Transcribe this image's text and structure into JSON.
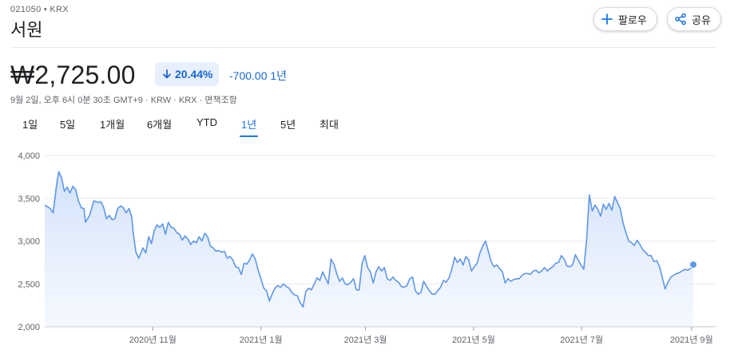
{
  "stock": {
    "ticker_line": "021050 • KRX",
    "name": "서원",
    "price": "₩2,725.00",
    "change_percent": "20.44%",
    "change_value": "-700.00 1년",
    "meta": "9월 2일, 오후 6시 0분 30초 GMT+9 · KRW · KRX · 면책조항"
  },
  "actions": {
    "follow_label": "팔로우",
    "share_label": "공유"
  },
  "tabs": [
    {
      "label": "1일"
    },
    {
      "label": "5일"
    },
    {
      "label": "1개월"
    },
    {
      "label": "6개월"
    },
    {
      "label": "YTD"
    },
    {
      "label": "1년"
    },
    {
      "label": "5년"
    },
    {
      "label": "최대"
    }
  ],
  "active_tab": "1년",
  "colors": {
    "line": "#5e97e8",
    "fill": "#dbe7fb",
    "accent": "#1a73e8",
    "change": "#1967d2"
  },
  "chart_data": {
    "type": "area",
    "ylim": [
      2000,
      4000
    ],
    "y_ticks": [
      4000,
      3500,
      3000,
      2500,
      2000
    ],
    "y_tick_labels": [
      "4,000",
      "3,500",
      "3,000",
      "2,500",
      "2,000"
    ],
    "x_ticks": [
      {
        "label": "2020년 11월",
        "day": 61
      },
      {
        "label": "2021년 1월",
        "day": 122
      },
      {
        "label": "2021년 3월",
        "day": 181
      },
      {
        "label": "2021년 5월",
        "day": 242
      },
      {
        "label": "2021년 7월",
        "day": 303
      },
      {
        "label": "2021년 9월",
        "day": 365
      }
    ],
    "x_range": [
      0,
      366
    ],
    "series": [
      {
        "values": [
          [
            0,
            3420
          ],
          [
            4,
            3380
          ],
          [
            6,
            3330
          ],
          [
            8,
            3600
          ],
          [
            9,
            3720
          ],
          [
            10,
            3810
          ],
          [
            12,
            3740
          ],
          [
            14,
            3580
          ],
          [
            16,
            3630
          ],
          [
            18,
            3560
          ],
          [
            20,
            3640
          ],
          [
            22,
            3600
          ],
          [
            24,
            3470
          ],
          [
            26,
            3390
          ],
          [
            28,
            3380
          ],
          [
            29,
            3220
          ],
          [
            32,
            3300
          ],
          [
            35,
            3470
          ],
          [
            38,
            3450
          ],
          [
            40,
            3460
          ],
          [
            42,
            3390
          ],
          [
            44,
            3260
          ],
          [
            46,
            3300
          ],
          [
            48,
            3250
          ],
          [
            50,
            3260
          ],
          [
            52,
            3380
          ],
          [
            54,
            3410
          ],
          [
            56,
            3390
          ],
          [
            58,
            3330
          ],
          [
            60,
            3380
          ],
          [
            62,
            3280
          ],
          [
            63,
            3100
          ],
          [
            65,
            2870
          ],
          [
            67,
            2800
          ],
          [
            70,
            2920
          ],
          [
            72,
            2860
          ],
          [
            74,
            3050
          ],
          [
            76,
            2970
          ],
          [
            78,
            3120
          ],
          [
            80,
            3190
          ],
          [
            82,
            3160
          ],
          [
            84,
            3200
          ],
          [
            86,
            3080
          ],
          [
            88,
            3220
          ],
          [
            90,
            3160
          ],
          [
            92,
            3150
          ],
          [
            94,
            3100
          ],
          [
            96,
            3080
          ],
          [
            98,
            3010
          ],
          [
            100,
            3060
          ],
          [
            102,
            3020
          ],
          [
            104,
            2960
          ],
          [
            106,
            3000
          ],
          [
            108,
            2980
          ],
          [
            110,
            3050
          ],
          [
            112,
            3000
          ],
          [
            114,
            3090
          ],
          [
            116,
            3050
          ],
          [
            118,
            2940
          ],
          [
            120,
            2920
          ],
          [
            122,
            2880
          ],
          [
            124,
            2890
          ],
          [
            126,
            2870
          ],
          [
            128,
            2880
          ],
          [
            130,
            2800
          ],
          [
            132,
            2820
          ],
          [
            134,
            2780
          ],
          [
            136,
            2700
          ],
          [
            138,
            2690
          ],
          [
            140,
            2610
          ],
          [
            142,
            2740
          ],
          [
            144,
            2730
          ],
          [
            146,
            2780
          ],
          [
            148,
            2850
          ],
          [
            150,
            2790
          ],
          [
            152,
            2660
          ],
          [
            154,
            2560
          ],
          [
            156,
            2450
          ],
          [
            158,
            2420
          ],
          [
            160,
            2300
          ],
          [
            162,
            2380
          ],
          [
            164,
            2450
          ],
          [
            166,
            2480
          ],
          [
            168,
            2460
          ],
          [
            170,
            2500
          ],
          [
            172,
            2470
          ],
          [
            174,
            2450
          ],
          [
            176,
            2400
          ],
          [
            178,
            2370
          ],
          [
            180,
            2360
          ],
          [
            182,
            2280
          ],
          [
            184,
            2230
          ],
          [
            186,
            2410
          ],
          [
            188,
            2450
          ],
          [
            190,
            2430
          ],
          [
            192,
            2500
          ],
          [
            194,
            2570
          ],
          [
            196,
            2540
          ],
          [
            198,
            2640
          ],
          [
            200,
            2570
          ],
          [
            202,
            2500
          ],
          [
            204,
            2790
          ],
          [
            206,
            2730
          ],
          [
            208,
            2620
          ],
          [
            210,
            2530
          ],
          [
            212,
            2570
          ],
          [
            214,
            2500
          ],
          [
            216,
            2490
          ],
          [
            218,
            2520
          ],
          [
            220,
            2560
          ],
          [
            222,
            2430
          ],
          [
            224,
            2430
          ],
          [
            226,
            2730
          ],
          [
            228,
            2830
          ],
          [
            230,
            2690
          ],
          [
            232,
            2640
          ],
          [
            234,
            2510
          ],
          [
            236,
            2640
          ],
          [
            238,
            2700
          ],
          [
            240,
            2650
          ],
          [
            242,
            2690
          ],
          [
            244,
            2560
          ],
          [
            246,
            2540
          ],
          [
            248,
            2580
          ],
          [
            250,
            2540
          ],
          [
            252,
            2520
          ],
          [
            254,
            2470
          ],
          [
            256,
            2460
          ],
          [
            258,
            2480
          ],
          [
            260,
            2560
          ],
          [
            262,
            2580
          ],
          [
            264,
            2420
          ],
          [
            266,
            2380
          ],
          [
            268,
            2400
          ],
          [
            270,
            2530
          ],
          [
            272,
            2470
          ],
          [
            274,
            2420
          ],
          [
            276,
            2380
          ],
          [
            278,
            2380
          ],
          [
            280,
            2420
          ],
          [
            282,
            2460
          ],
          [
            284,
            2540
          ],
          [
            286,
            2520
          ],
          [
            288,
            2570
          ],
          [
            290,
            2670
          ],
          [
            292,
            2810
          ],
          [
            294,
            2750
          ],
          [
            296,
            2790
          ],
          [
            298,
            2720
          ],
          [
            300,
            2820
          ],
          [
            302,
            2780
          ],
          [
            304,
            2650
          ],
          [
            306,
            2700
          ],
          [
            308,
            2740
          ],
          [
            310,
            2860
          ],
          [
            312,
            2940
          ],
          [
            314,
            3000
          ],
          [
            316,
            2880
          ],
          [
            318,
            2760
          ],
          [
            320,
            2700
          ],
          [
            322,
            2720
          ],
          [
            324,
            2680
          ],
          [
            326,
            2640
          ],
          [
            328,
            2510
          ],
          [
            330,
            2560
          ],
          [
            332,
            2530
          ],
          [
            334,
            2550
          ],
          [
            336,
            2560
          ],
          [
            338,
            2560
          ],
          [
            340,
            2600
          ],
          [
            342,
            2620
          ],
          [
            344,
            2620
          ],
          [
            346,
            2610
          ],
          [
            348,
            2650
          ],
          [
            350,
            2660
          ],
          [
            352,
            2630
          ],
          [
            354,
            2650
          ],
          [
            356,
            2690
          ],
          [
            358,
            2650
          ],
          [
            360,
            2680
          ],
          [
            362,
            2700
          ],
          [
            364,
            2740
          ],
          [
            366,
            2750
          ],
          [
            368,
            2830
          ],
          [
            370,
            2790
          ],
          [
            372,
            2710
          ],
          [
            374,
            2700
          ],
          [
            376,
            2720
          ],
          [
            378,
            2840
          ],
          [
            380,
            2780
          ],
          [
            382,
            2720
          ],
          [
            384,
            2670
          ],
          [
            386,
            3010
          ],
          [
            388,
            3540
          ],
          [
            390,
            3350
          ],
          [
            392,
            3420
          ],
          [
            394,
            3370
          ],
          [
            396,
            3290
          ],
          [
            398,
            3430
          ],
          [
            400,
            3370
          ],
          [
            402,
            3440
          ],
          [
            404,
            3360
          ],
          [
            406,
            3520
          ],
          [
            408,
            3450
          ],
          [
            410,
            3380
          ],
          [
            412,
            3210
          ],
          [
            414,
            3100
          ],
          [
            416,
            3000
          ],
          [
            418,
            2980
          ],
          [
            420,
            2950
          ],
          [
            422,
            3010
          ],
          [
            424,
            2960
          ],
          [
            426,
            2900
          ],
          [
            428,
            2870
          ],
          [
            430,
            2830
          ],
          [
            432,
            2830
          ],
          [
            434,
            2760
          ],
          [
            436,
            2770
          ],
          [
            438,
            2700
          ],
          [
            440,
            2570
          ],
          [
            442,
            2440
          ],
          [
            444,
            2520
          ],
          [
            446,
            2580
          ],
          [
            448,
            2600
          ],
          [
            450,
            2620
          ],
          [
            452,
            2630
          ],
          [
            454,
            2650
          ],
          [
            456,
            2670
          ],
          [
            458,
            2660
          ],
          [
            460,
            2680
          ],
          [
            462,
            2725
          ]
        ]
      }
    ]
  }
}
